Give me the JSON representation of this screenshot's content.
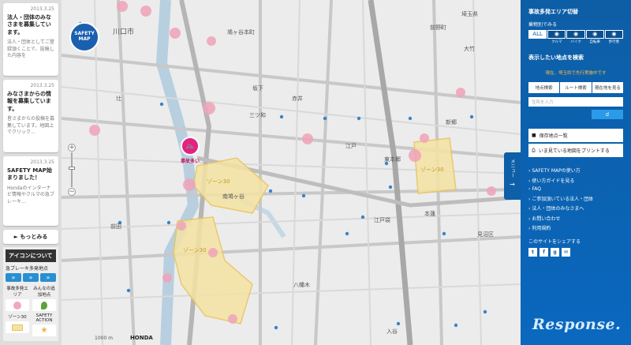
{
  "news": [
    {
      "date": "2013.3.25",
      "title": "法人・団体のみなさまを募集しています。",
      "body": "法人・団体としてご登録頂くことで、投稿した内容を"
    },
    {
      "date": "2013.3.25",
      "title": "みなさまからの情報を募集しています。",
      "body": "皆さまからの投稿を募集しています。地図上でクリック..."
    },
    {
      "date": "2013.3.25",
      "title": "SAFETY MAP始まりました！",
      "body": "Hondaのインターナビ情報やクルマの急ブレーキ..."
    }
  ],
  "more_label": "もっとみる",
  "legend": {
    "header": "アイコンについて",
    "brake_label": "急ブレーキ多発地点",
    "area_label": "事故多発エリア",
    "spot_label": "みんなの追加地点",
    "zone_label": "ゾーン30",
    "action_label": "SAFETY ACTION"
  },
  "logo": "SAFETY MAP",
  "accident_label": "事故多い",
  "map_labels": [
    {
      "text": "川口市",
      "cls": "big"
    },
    {
      "text": "埼玉県"
    },
    {
      "text": "坂下"
    },
    {
      "text": "赤井"
    },
    {
      "text": "三ツ和"
    },
    {
      "text": "江戸"
    },
    {
      "text": "東本郷"
    },
    {
      "text": "本蓮"
    },
    {
      "text": "南鳩ヶ谷"
    },
    {
      "text": "鳩ヶ谷本町"
    },
    {
      "text": "前田"
    },
    {
      "text": "八幡木"
    },
    {
      "text": "江戸袋"
    },
    {
      "text": "見沼区"
    },
    {
      "text": "前野町"
    },
    {
      "text": "大竹"
    },
    {
      "text": "入谷"
    },
    {
      "text": "新郷"
    },
    {
      "text": "辻"
    },
    {
      "text": "ゾーン30"
    },
    {
      "text": "ゾーン30"
    },
    {
      "text": "ゾーン30"
    }
  ],
  "panel": {
    "title": "事故多発エリア切替",
    "mode_label": "乗物別でみる",
    "modes": [
      "ALL",
      "クルマ",
      "バイク",
      "自転車",
      "歩行者"
    ],
    "search_title": "表示したい地点を検索",
    "notice": "現在、埼玉県で先行実施中です",
    "tabs": [
      "地点検索",
      "ルート検索",
      "現在地を見る"
    ],
    "addr_placeholder": "住所を入力",
    "save_label": "保存地点一覧",
    "print_label": "いま見ている地図をプリントする",
    "links": [
      "SAFETY MAPの使い方",
      "使い方ガイドを見る",
      "FAQ",
      "ご参加頂いている法人・団体",
      "法人・団体のみなさまへ",
      "お問い合わせ",
      "利用規約"
    ],
    "share_title": "このサイトをシェアする"
  },
  "menu_label": "メニュー",
  "scale_label": "1000 m",
  "brand_label": "HONDA",
  "watermark": "Response."
}
